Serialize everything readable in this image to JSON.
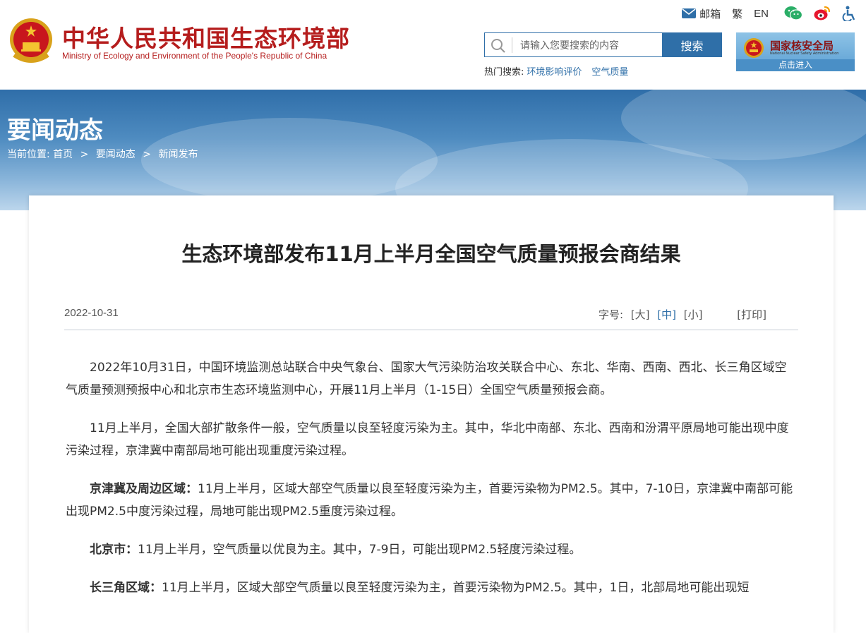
{
  "site": {
    "title_cn": "中华人民共和国生态环境部",
    "title_en": "Ministry of Ecology and Environment of the People's Republic of China"
  },
  "toplinks": {
    "mail": "邮箱",
    "traditional": "繁",
    "english": "EN"
  },
  "search": {
    "placeholder": "请输入您要搜索的内容",
    "button": "搜索",
    "hot_label": "热门搜索:",
    "hot_items": [
      "环境影响评价",
      "空气质量"
    ]
  },
  "nnsa": {
    "name_cn": "国家核安全局",
    "name_en": "National Nuclear Safety Administration",
    "enter": "点击进入"
  },
  "banner": {
    "title": "要闻动态",
    "breadcrumb_label": "当前位置:",
    "breadcrumb": [
      "首页",
      "要闻动态",
      "新闻发布"
    ],
    "separator": ">"
  },
  "article": {
    "title": "生态环境部发布11月上半月全国空气质量预报会商结果",
    "date": "2022-10-31",
    "font_size_label": "字号:",
    "font_sizes": [
      "[大]",
      "[中]",
      "[小]"
    ],
    "print": "[打印]",
    "paragraphs": [
      {
        "lead": "",
        "text": "2022年10月31日，中国环境监测总站联合中央气象台、国家大气污染防治攻关联合中心、东北、华南、西南、西北、长三角区域空气质量预测预报中心和北京市生态环境监测中心，开展11月上半月（1-15日）全国空气质量预报会商。"
      },
      {
        "lead": "",
        "text": "11月上半月，全国大部扩散条件一般，空气质量以良至轻度污染为主。其中，华北中南部、东北、西南和汾渭平原局地可能出现中度污染过程，京津冀中南部局地可能出现重度污染过程。"
      },
      {
        "lead": "京津冀及周边区域：",
        "text": "11月上半月，区域大部空气质量以良至轻度污染为主，首要污染物为PM2.5。其中，7-10日，京津冀中南部可能出现PM2.5中度污染过程，局地可能出现PM2.5重度污染过程。"
      },
      {
        "lead": "北京市：",
        "text": "11月上半月，空气质量以优良为主。其中，7-9日，可能出现PM2.5轻度污染过程。"
      },
      {
        "lead": "长三角区域：",
        "text": "11月上半月，区域大部空气质量以良至轻度污染为主，首要污染物为PM2.5。其中，1日，北部局地可能出现短"
      }
    ]
  },
  "colors": {
    "brand_red": "#b51d1d",
    "link_blue": "#2f6fa8"
  }
}
